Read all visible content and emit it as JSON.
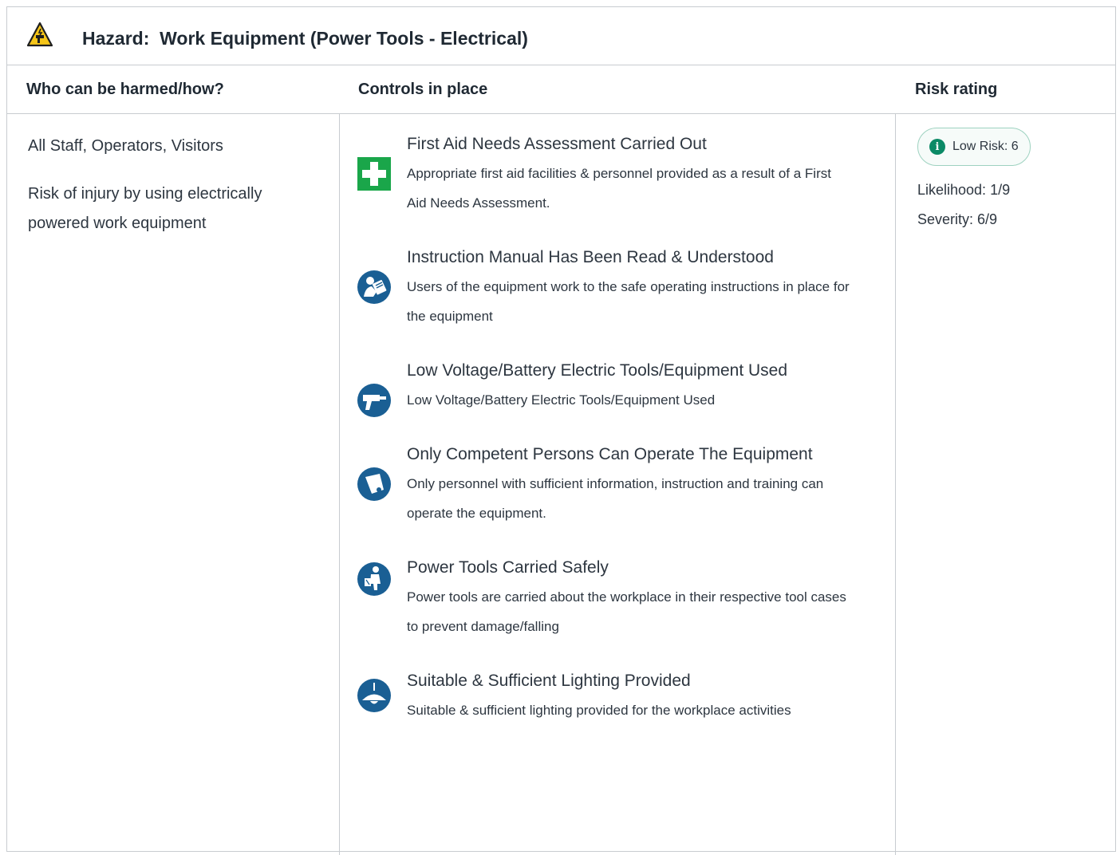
{
  "hazard": {
    "icon": "power-tool-warning-icon",
    "title": "Hazard:  Work Equipment (Power Tools - Electrical)"
  },
  "columns": {
    "who": "Who can be harmed/how?",
    "controls": "Controls in place",
    "risk": "Risk rating"
  },
  "who": {
    "people": "All Staff, Operators, Visitors",
    "description": "Risk of injury by using electrically powered work equipment"
  },
  "controls": [
    {
      "icon": "first-aid-icon",
      "title": "First Aid Needs Assessment Carried Out",
      "description": "Appropriate first aid facilities & personnel provided as a result of a First Aid Needs Assessment."
    },
    {
      "icon": "read-manual-icon",
      "title": "Instruction Manual Has Been Read & Understood",
      "description": "Users of the equipment work to the safe operating instructions in place for the equipment"
    },
    {
      "icon": "drill-icon",
      "title": "Low Voltage/Battery Electric Tools/Equipment Used",
      "description": "Low Voltage/Battery Electric Tools/Equipment Used"
    },
    {
      "icon": "certificate-icon",
      "title": "Only Competent Persons Can Operate The Equipment",
      "description": "Only personnel with sufficient information, instruction and training can operate the equipment."
    },
    {
      "icon": "carry-tools-icon",
      "title": "Power Tools Carried Safely",
      "description": "Power tools are carried about the workplace in their respective tool cases to prevent damage/falling"
    },
    {
      "icon": "lamp-icon",
      "title": "Suitable & Sufficient Lighting Provided",
      "description": "Suitable & sufficient lighting provided for the workplace activities"
    }
  ],
  "risk": {
    "badge": "Low Risk: 6",
    "likelihood": "Likelihood: 1/9",
    "severity": "Severity: 6/9",
    "color": "#0b8a66"
  },
  "colors": {
    "border": "#c8ccd0",
    "icon_blue": "#1a5f94",
    "first_aid_green": "#1aa64a",
    "warning_yellow": "#f5c518"
  }
}
